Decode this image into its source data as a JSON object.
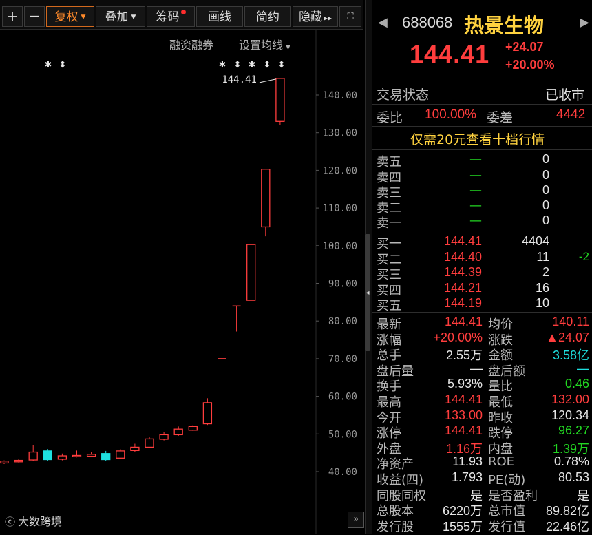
{
  "toolbar": {
    "plus": "+",
    "minus": "一",
    "fuquan": "复权",
    "diejia": "叠加",
    "chouma": "筹码",
    "huaxian": "画线",
    "jianyue": "简约",
    "yincang": "隐藏",
    "yincang_arrows": "▸▸"
  },
  "chart_links": {
    "margin": "融资融券",
    "ma_settings": "设置均线"
  },
  "chart_data": {
    "type": "candlestick",
    "high_label": "144.41",
    "y_ticks": [
      "140.00",
      "130.00",
      "120.00",
      "110.00",
      "100.00",
      "90.00",
      "80.00",
      "70.00",
      "60.00",
      "50.00",
      "40.00"
    ],
    "ylim": [
      36,
      146
    ],
    "candles": [
      {
        "o": 42.3,
        "c": 42.8,
        "h": 43.0,
        "l": 42.0
      },
      {
        "o": 42.6,
        "c": 43.0,
        "h": 43.4,
        "l": 42.4
      },
      {
        "o": 43.1,
        "c": 45.2,
        "h": 47.1,
        "l": 42.8
      },
      {
        "o": 45.5,
        "c": 43.2,
        "h": 46.0,
        "l": 42.9
      },
      {
        "o": 43.3,
        "c": 44.2,
        "h": 44.8,
        "l": 43.0
      },
      {
        "o": 44.0,
        "c": 44.3,
        "h": 45.6,
        "l": 43.8
      },
      {
        "o": 44.1,
        "c": 44.6,
        "h": 45.2,
        "l": 43.9
      },
      {
        "o": 44.8,
        "c": 43.2,
        "h": 45.5,
        "l": 42.8
      },
      {
        "o": 43.6,
        "c": 45.5,
        "h": 46.0,
        "l": 43.3
      },
      {
        "o": 45.6,
        "c": 46.5,
        "h": 47.4,
        "l": 45.2
      },
      {
        "o": 46.5,
        "c": 48.7,
        "h": 49.2,
        "l": 46.3
      },
      {
        "o": 48.6,
        "c": 49.8,
        "h": 50.5,
        "l": 48.3
      },
      {
        "o": 49.8,
        "c": 51.3,
        "h": 52.0,
        "l": 49.5
      },
      {
        "o": 51.0,
        "c": 52.0,
        "h": 52.4,
        "l": 50.8
      },
      {
        "o": 52.7,
        "c": 58.3,
        "h": 59.5,
        "l": 52.4
      },
      {
        "o": 70.0,
        "c": 70.0,
        "h": 70.0,
        "l": 70.0
      },
      {
        "o": 84.0,
        "c": 84.0,
        "h": 84.0,
        "l": 77.2
      },
      {
        "o": 85.5,
        "c": 100.3,
        "h": 100.3,
        "l": 85.5
      },
      {
        "o": 105.0,
        "c": 120.3,
        "h": 120.3,
        "l": 102.5
      },
      {
        "o": 133.0,
        "c": 144.41,
        "h": 144.41,
        "l": 132.0
      }
    ]
  },
  "stock": {
    "code": "688068",
    "name": "热景生物",
    "price": "144.41",
    "change": "+24.07",
    "change_pct": "+20.00%"
  },
  "status": {
    "label": "交易状态",
    "value": "已收市"
  },
  "weibi": {
    "label": "委比",
    "value": "100.00%",
    "label2": "委差",
    "value2": "4442"
  },
  "promo": "仅需20元查看十档行情",
  "sell": [
    {
      "label": "卖五",
      "price": "—",
      "vol": "0"
    },
    {
      "label": "卖四",
      "price": "—",
      "vol": "0"
    },
    {
      "label": "卖三",
      "price": "—",
      "vol": "0"
    },
    {
      "label": "卖二",
      "price": "—",
      "vol": "0"
    },
    {
      "label": "卖一",
      "price": "—",
      "vol": "0"
    }
  ],
  "buy": [
    {
      "label": "买一",
      "price": "144.41",
      "vol": "4404",
      "chg": ""
    },
    {
      "label": "买二",
      "price": "144.40",
      "vol": "11",
      "chg": "-2"
    },
    {
      "label": "买三",
      "price": "144.39",
      "vol": "2",
      "chg": ""
    },
    {
      "label": "买四",
      "price": "144.21",
      "vol": "16",
      "chg": ""
    },
    {
      "label": "买五",
      "price": "144.19",
      "vol": "10",
      "chg": ""
    }
  ],
  "stats": [
    {
      "l1": "最新",
      "v1": "144.41",
      "c1": "red",
      "l2": "均价",
      "v2": "140.11",
      "c2": "red"
    },
    {
      "l1": "涨幅",
      "v1": "+20.00%",
      "c1": "red",
      "l2": "涨跌",
      "v2": "▲24.07",
      "c2": "red"
    },
    {
      "l1": "总手",
      "v1": "2.55万",
      "c1": "white",
      "l2": "金额",
      "v2": "3.58亿",
      "c2": "cyan"
    },
    {
      "l1": "盘后量",
      "v1": "—",
      "c1": "white",
      "l2": "盘后额",
      "v2": "—",
      "c2": "cyan"
    },
    {
      "l1": "换手",
      "v1": "5.93%",
      "c1": "white",
      "l2": "量比",
      "v2": "0.46",
      "c2": "green"
    },
    {
      "l1": "最高",
      "v1": "144.41",
      "c1": "red",
      "l2": "最低",
      "v2": "132.00",
      "c2": "red"
    },
    {
      "l1": "今开",
      "v1": "133.00",
      "c1": "red",
      "l2": "昨收",
      "v2": "120.34",
      "c2": "white"
    },
    {
      "l1": "涨停",
      "v1": "144.41",
      "c1": "red",
      "l2": "跌停",
      "v2": "96.27",
      "c2": "green"
    },
    {
      "l1": "外盘",
      "v1": "1.16万",
      "c1": "red",
      "l2": "内盘",
      "v2": "1.39万",
      "c2": "green"
    },
    {
      "l1": "净资产",
      "v1": "11.93",
      "c1": "white",
      "l2": "ROE",
      "v2": "0.78%",
      "c2": "white"
    },
    {
      "l1": "收益(四)",
      "v1": "1.793",
      "c1": "white",
      "l2": "PE(动)",
      "v2": "80.53",
      "c2": "white"
    },
    {
      "l1": "同股同权",
      "v1": "是",
      "c1": "white",
      "l2": "是否盈利",
      "v2": "是",
      "c2": "white"
    },
    {
      "l1": "总股本",
      "v1": "6220万",
      "c1": "white",
      "l2": "总市值",
      "v2": "89.82亿",
      "c2": "white"
    },
    {
      "l1": "发行股",
      "v1": "1555万",
      "c1": "white",
      "l2": "发行值",
      "v2": "22.46亿",
      "c2": "white"
    }
  ],
  "watermark": "大数跨境",
  "colors": {
    "up": "#ff3d3d",
    "down": "#1ee0e0",
    "accent": "#ff8a2a",
    "name": "#ffd23f"
  }
}
